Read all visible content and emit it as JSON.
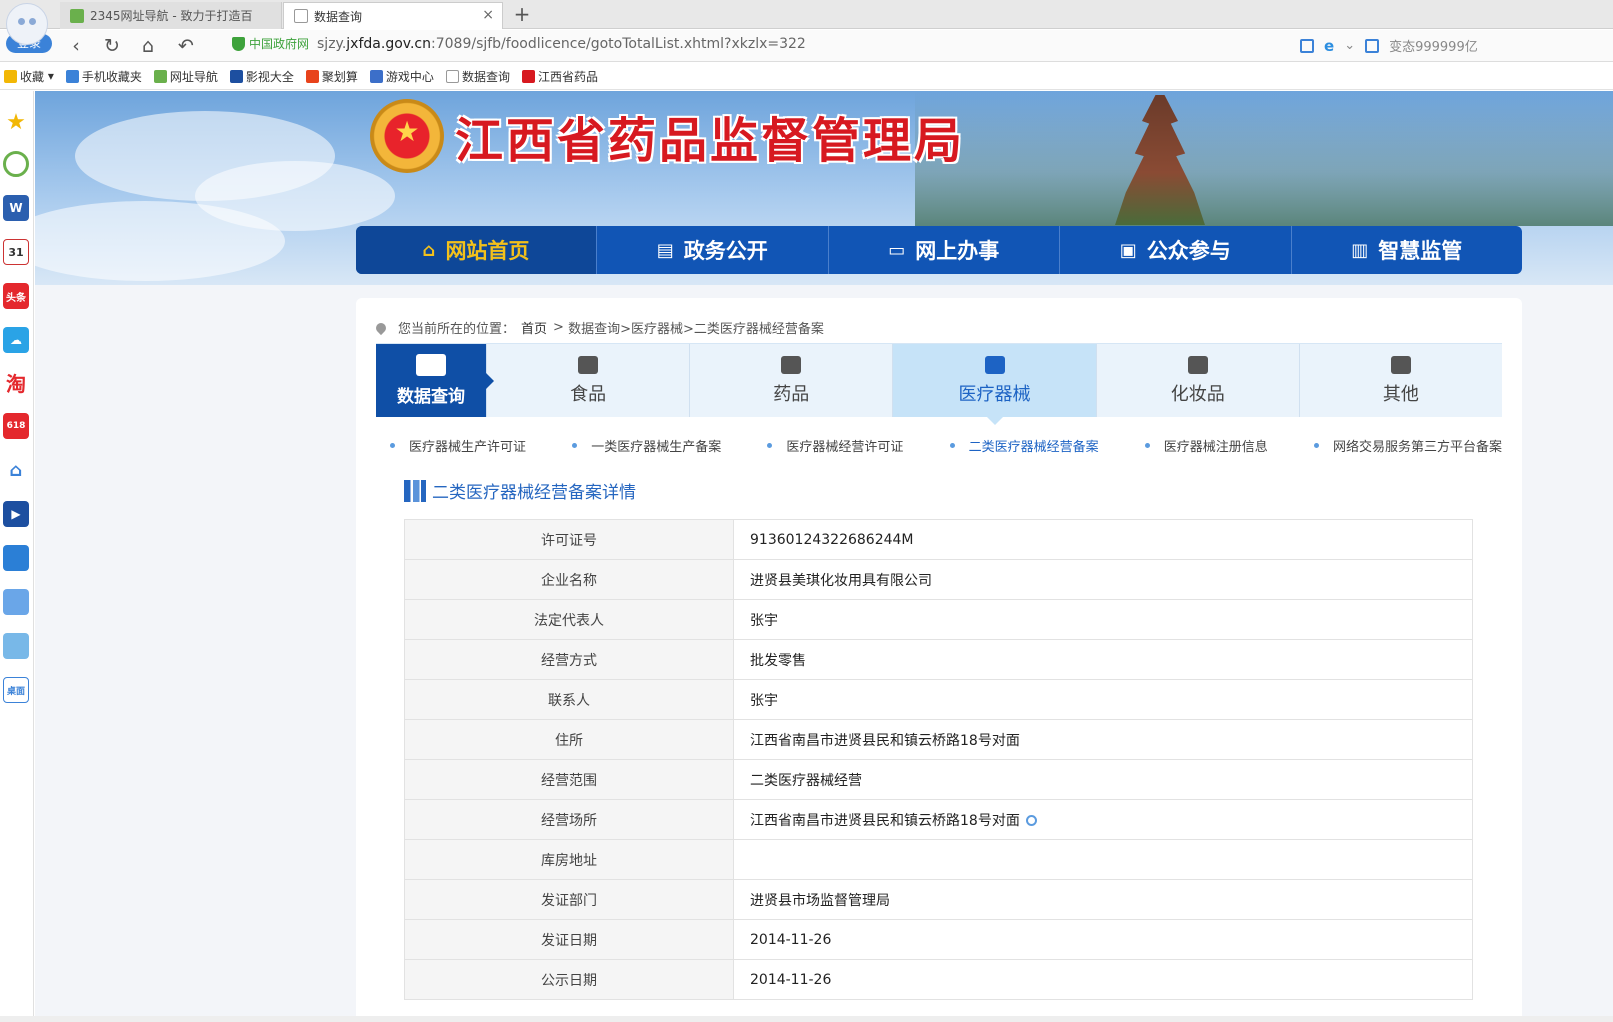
{
  "browser": {
    "tabs": [
      {
        "title": "2345网址导航 - 致力于打造百"
      },
      {
        "title": "数据查询"
      }
    ],
    "new_tab": "+",
    "login": "登录",
    "url_badge": "中国政府网",
    "url_prefix": "sjzy.",
    "url_domain": "jxfda.gov.cn",
    "url_rest": ":7089/sjfb/foodlicence/gotoTotalList.xhtml?xkzlx=322",
    "status_text": "变态999999亿",
    "bookmarks": [
      "收藏",
      "手机收藏夹",
      "网址导航",
      "影视大全",
      "聚划算",
      "游戏中心",
      "数据查询",
      "江西省药品"
    ]
  },
  "site": {
    "title": "江西省药品监督管理局",
    "nav": [
      {
        "label": "网站首页",
        "icon": "home-icon"
      },
      {
        "label": "政务公开",
        "icon": "document-icon"
      },
      {
        "label": "网上办事",
        "icon": "monitor-icon"
      },
      {
        "label": "公众参与",
        "icon": "chat-icon"
      },
      {
        "label": "智慧监管",
        "icon": "chart-icon"
      }
    ]
  },
  "breadcrumb": {
    "label": "您当前所在的位置：",
    "home": "首页",
    "sep": ">",
    "rest": "数据查询>医疗器械>二类医疗器械经营备案"
  },
  "category_tabs": {
    "main": "数据查询",
    "items": [
      "食品",
      "药品",
      "医疗器械",
      "化妆品",
      "其他"
    ],
    "selected": "医疗器械"
  },
  "sub_tabs": {
    "items": [
      "医疗器械生产许可证",
      "一类医疗器械生产备案",
      "医疗器械经营许可证",
      "二类医疗器械经营备案",
      "医疗器械注册信息",
      "网络交易服务第三方平台备案"
    ],
    "selected": "二类医疗器械经营备案"
  },
  "section_title": "二类医疗器械经营备案详情",
  "details": [
    {
      "key": "许可证号",
      "value": "91360124322686244M"
    },
    {
      "key": "企业名称",
      "value": "进贤县美琪化妆用具有限公司"
    },
    {
      "key": "法定代表人",
      "value": "张宇"
    },
    {
      "key": "经营方式",
      "value": "批发零售"
    },
    {
      "key": "联系人",
      "value": "张宇"
    },
    {
      "key": "住所",
      "value": "江西省南昌市进贤县民和镇云桥路18号对面"
    },
    {
      "key": "经营范围",
      "value": "二类医疗器械经营"
    },
    {
      "key": "经营场所",
      "value": "江西省南昌市进贤县民和镇云桥路18号对面"
    },
    {
      "key": "库房地址",
      "value": ""
    },
    {
      "key": "发证部门",
      "value": "进贤县市场监督管理局"
    },
    {
      "key": "发证日期",
      "value": "2014-11-26"
    },
    {
      "key": "公示日期",
      "value": "2014-11-26"
    }
  ]
}
